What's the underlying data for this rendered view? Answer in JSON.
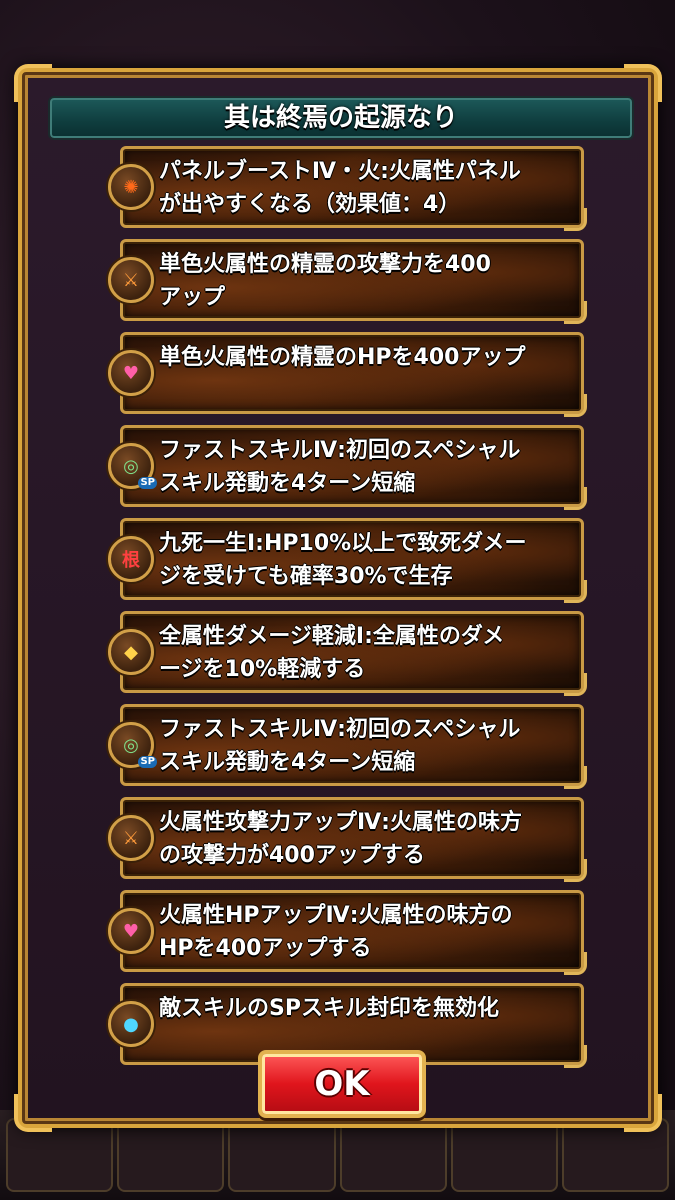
{
  "modal": {
    "title": "其は終焉の起源なり",
    "ok_label": "OK"
  },
  "abilities": [
    {
      "icon": "fire-panel-boost-icon",
      "symbol": "✺",
      "sp": "",
      "color": "#ff6a1a",
      "text": "パネルブーストⅣ・火:火属性パネル\nが出やすくなる（効果値：4）"
    },
    {
      "icon": "attack-up-icon",
      "symbol": "⚔",
      "sp": "",
      "color": "#ff9b3a",
      "text": "単色火属性の精霊の攻撃力を400\nアップ"
    },
    {
      "icon": "hp-up-icon",
      "symbol": "♥",
      "sp": "",
      "color": "#ff5fa8",
      "text": "単色火属性の精霊のHPを400アップ"
    },
    {
      "icon": "fast-skill-icon",
      "symbol": "◎",
      "sp": "SP",
      "color": "#7fe08a",
      "text": "ファストスキルⅣ:初回のスペシャル\nスキル発動を4ターン短縮"
    },
    {
      "icon": "guts-icon",
      "symbol": "根",
      "sp": "",
      "color": "#ff4040",
      "text": "九死一生Ⅰ:HP10%以上で致死ダメー\nジを受けても確率30%で生存"
    },
    {
      "icon": "damage-reduce-icon",
      "symbol": "◆",
      "sp": "",
      "color": "#ffd24a",
      "text": "全属性ダメージ軽減Ⅰ:全属性のダメ\nージを10%軽減する"
    },
    {
      "icon": "fast-skill-icon",
      "symbol": "◎",
      "sp": "SP",
      "color": "#7fe08a",
      "text": "ファストスキルⅣ:初回のスペシャル\nスキル発動を4ターン短縮"
    },
    {
      "icon": "attack-up-icon",
      "symbol": "⚔",
      "sp": "",
      "color": "#ff9b3a",
      "text": "火属性攻撃力アップⅣ:火属性の味方\nの攻撃力が400アップする"
    },
    {
      "icon": "hp-up-icon",
      "symbol": "♥",
      "sp": "",
      "color": "#ff5fa8",
      "text": "火属性HPアップⅣ:火属性の味方の\nHPを400アップする"
    },
    {
      "icon": "sp-seal-guard-icon",
      "symbol": "●",
      "sp": "",
      "color": "#4fd7ff",
      "text": "敵スキルのSPスキル封印を無効化"
    }
  ]
}
